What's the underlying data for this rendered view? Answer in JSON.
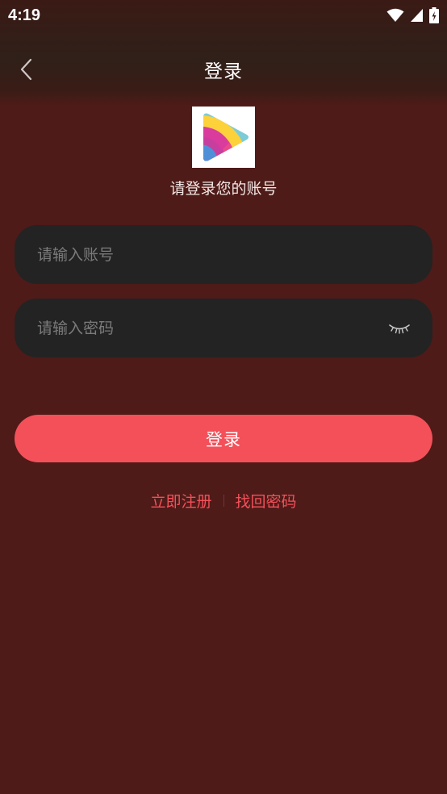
{
  "status_bar": {
    "time": "4:19",
    "icons": [
      "wifi-icon",
      "signal-icon",
      "battery-charging-icon"
    ]
  },
  "header": {
    "title": "登录",
    "back_icon": "chevron-left-icon"
  },
  "brand": {
    "logo_icon": "play-logo-icon",
    "subtitle": "请登录您的账号"
  },
  "form": {
    "account_placeholder": "请输入账号",
    "account_value": "",
    "password_placeholder": "请输入密码",
    "password_value": "",
    "password_toggle_icon": "eye-closed-icon",
    "submit_label": "登录"
  },
  "links": {
    "register_label": "立即注册",
    "forgot_label": "找回密码"
  },
  "colors": {
    "background": "#4e1b18",
    "field": "#232323",
    "accent": "#f4505a",
    "placeholder": "#7b7b7b"
  }
}
